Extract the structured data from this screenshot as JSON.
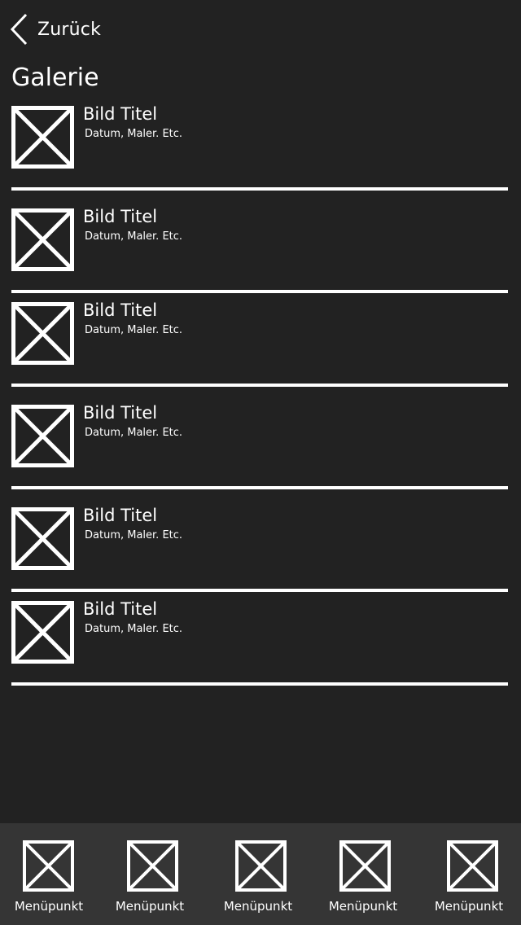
{
  "header": {
    "back_label": "Zurück",
    "back_icon": "chevron-left-icon",
    "title": "Galerie"
  },
  "gallery": {
    "items": [
      {
        "title": "Bild Titel",
        "meta": "Datum, Maler. Etc.",
        "icon": "image-placeholder-icon"
      },
      {
        "title": "Bild Titel",
        "meta": "Datum, Maler. Etc.",
        "icon": "image-placeholder-icon"
      },
      {
        "title": "Bild Titel",
        "meta": "Datum, Maler. Etc.",
        "icon": "image-placeholder-icon"
      },
      {
        "title": "Bild Titel",
        "meta": "Datum, Maler. Etc.",
        "icon": "image-placeholder-icon"
      },
      {
        "title": "Bild Titel",
        "meta": "Datum, Maler. Etc.",
        "icon": "image-placeholder-icon"
      },
      {
        "title": "Bild Titel",
        "meta": "Datum, Maler. Etc.",
        "icon": "image-placeholder-icon"
      }
    ]
  },
  "bottom_nav": {
    "items": [
      {
        "label": "Menüpunkt",
        "icon": "image-placeholder-icon"
      },
      {
        "label": "Menüpunkt",
        "icon": "image-placeholder-icon"
      },
      {
        "label": "Menüpunkt",
        "icon": "image-placeholder-icon"
      },
      {
        "label": "Menüpunkt",
        "icon": "image-placeholder-icon"
      },
      {
        "label": "Menüpunkt",
        "icon": "image-placeholder-icon"
      }
    ]
  },
  "colors": {
    "background": "#222222",
    "nav_background": "#353535",
    "foreground": "#ffffff"
  }
}
